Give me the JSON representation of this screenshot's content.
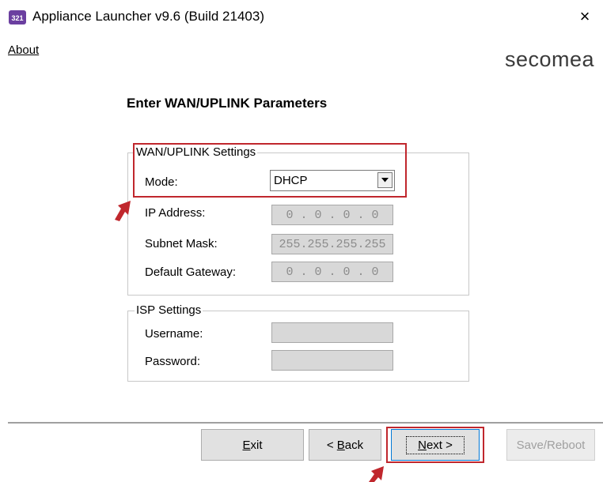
{
  "window": {
    "title": "Appliance Launcher v9.6 (Build 21403)",
    "app_icon_text": "321",
    "close_glyph": "×"
  },
  "menu": {
    "about": "About"
  },
  "logo": {
    "text": "secomea"
  },
  "page": {
    "heading": "Enter WAN/UPLINK Parameters"
  },
  "wan_settings": {
    "legend": "WAN/UPLINK Settings",
    "mode_label": "Mode:",
    "mode_value": "DHCP",
    "ip_label": "IP Address:",
    "ip_value": "0 . 0 . 0 . 0",
    "subnet_label": "Subnet Mask:",
    "subnet_value": "255.255.255.255",
    "gateway_label": "Default Gateway:",
    "gateway_value": "0 . 0 . 0 . 0"
  },
  "isp_settings": {
    "legend": "ISP Settings",
    "username_label": "Username:",
    "username_value": "",
    "password_label": "Password:",
    "password_value": ""
  },
  "buttons": {
    "exit": {
      "mnemonic": "E",
      "rest": "xit"
    },
    "back": {
      "prefix": "< ",
      "mnemonic": "B",
      "rest": "ack"
    },
    "next": {
      "mnemonic": "N",
      "rest": "ext >"
    },
    "save_reboot": "Save/Reboot"
  },
  "colors": {
    "highlight": "#c0272d",
    "logo": "#3a3a3a",
    "disabled_field": "#d8d8d8"
  }
}
